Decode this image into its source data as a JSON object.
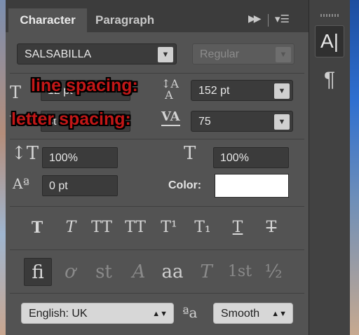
{
  "tabs": {
    "character": "Character",
    "paragraph": "Paragraph",
    "expand_icon": "double-chevron-right-icon",
    "menu_icon": "panel-menu-icon"
  },
  "font": {
    "family": "SALSABILLA",
    "style": "Regular"
  },
  "leading": {
    "value": "152 pt"
  },
  "kerning": {
    "value": "75"
  },
  "font_size_partial": "12 pt",
  "tracking_partial": "st",
  "vertical_scale": "100%",
  "horizontal_scale": "100%",
  "baseline_shift": "0 pt",
  "color": {
    "label": "Color:",
    "value": "#ffffff"
  },
  "annotations": {
    "line_spacing": "line spacing:",
    "letter_spacing": "letter spacing:"
  },
  "type_styles": [
    "T",
    "T",
    "TT",
    "TT",
    "T¹",
    "T₁",
    "T",
    "T"
  ],
  "opentype": [
    "fi",
    "ơ",
    "st",
    "A",
    "aa",
    "T",
    "1st",
    "½"
  ],
  "language": "English: UK",
  "antialias_icon_text": "ªa",
  "antialias": "Smooth",
  "dock": {
    "character_button": "A|",
    "paragraph_button": "¶"
  }
}
